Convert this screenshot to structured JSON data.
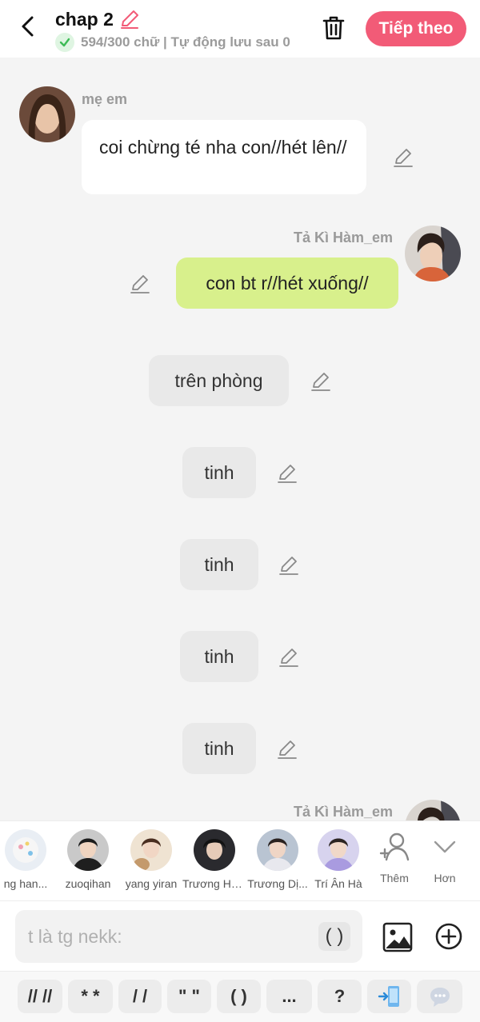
{
  "header": {
    "title": "chap 2",
    "status": "594/300 chữ | Tự động lưu sau 0",
    "next_label": "Tiếp theo"
  },
  "messages": [
    {
      "type": "left",
      "name": "mẹ em",
      "text": "coi chừng té nha con//hét lên//"
    },
    {
      "type": "right",
      "name": "Tả Kì Hàm_em",
      "text": "con bt r//hét xuống//"
    },
    {
      "type": "narration",
      "text": "trên phòng"
    },
    {
      "type": "narration",
      "text": "tinh"
    },
    {
      "type": "narration",
      "text": "tinh"
    },
    {
      "type": "narration",
      "text": "tinh"
    },
    {
      "type": "narration",
      "text": "tinh"
    },
    {
      "type": "right",
      "name": "Tả Kì Hàm_em",
      "text": ""
    }
  ],
  "characters": [
    {
      "name": "ng han..."
    },
    {
      "name": "zuoqihan"
    },
    {
      "name": "yang yiran"
    },
    {
      "name": "Trương Hà..."
    },
    {
      "name": "Trương Dị..."
    },
    {
      "name": "Trí Ân Hà"
    }
  ],
  "char_tools": {
    "add_label": "Thêm",
    "more_label": "Hơn"
  },
  "input": {
    "placeholder": "t là tg nekk:",
    "paren_label": "( )"
  },
  "symbols": [
    "// //",
    "* *",
    "/ /",
    "\" \"",
    "( )",
    "...",
    "?"
  ],
  "colors": {
    "accent": "#f25b77",
    "green_bubble": "#d8f08c",
    "check": "#3dbb56"
  }
}
